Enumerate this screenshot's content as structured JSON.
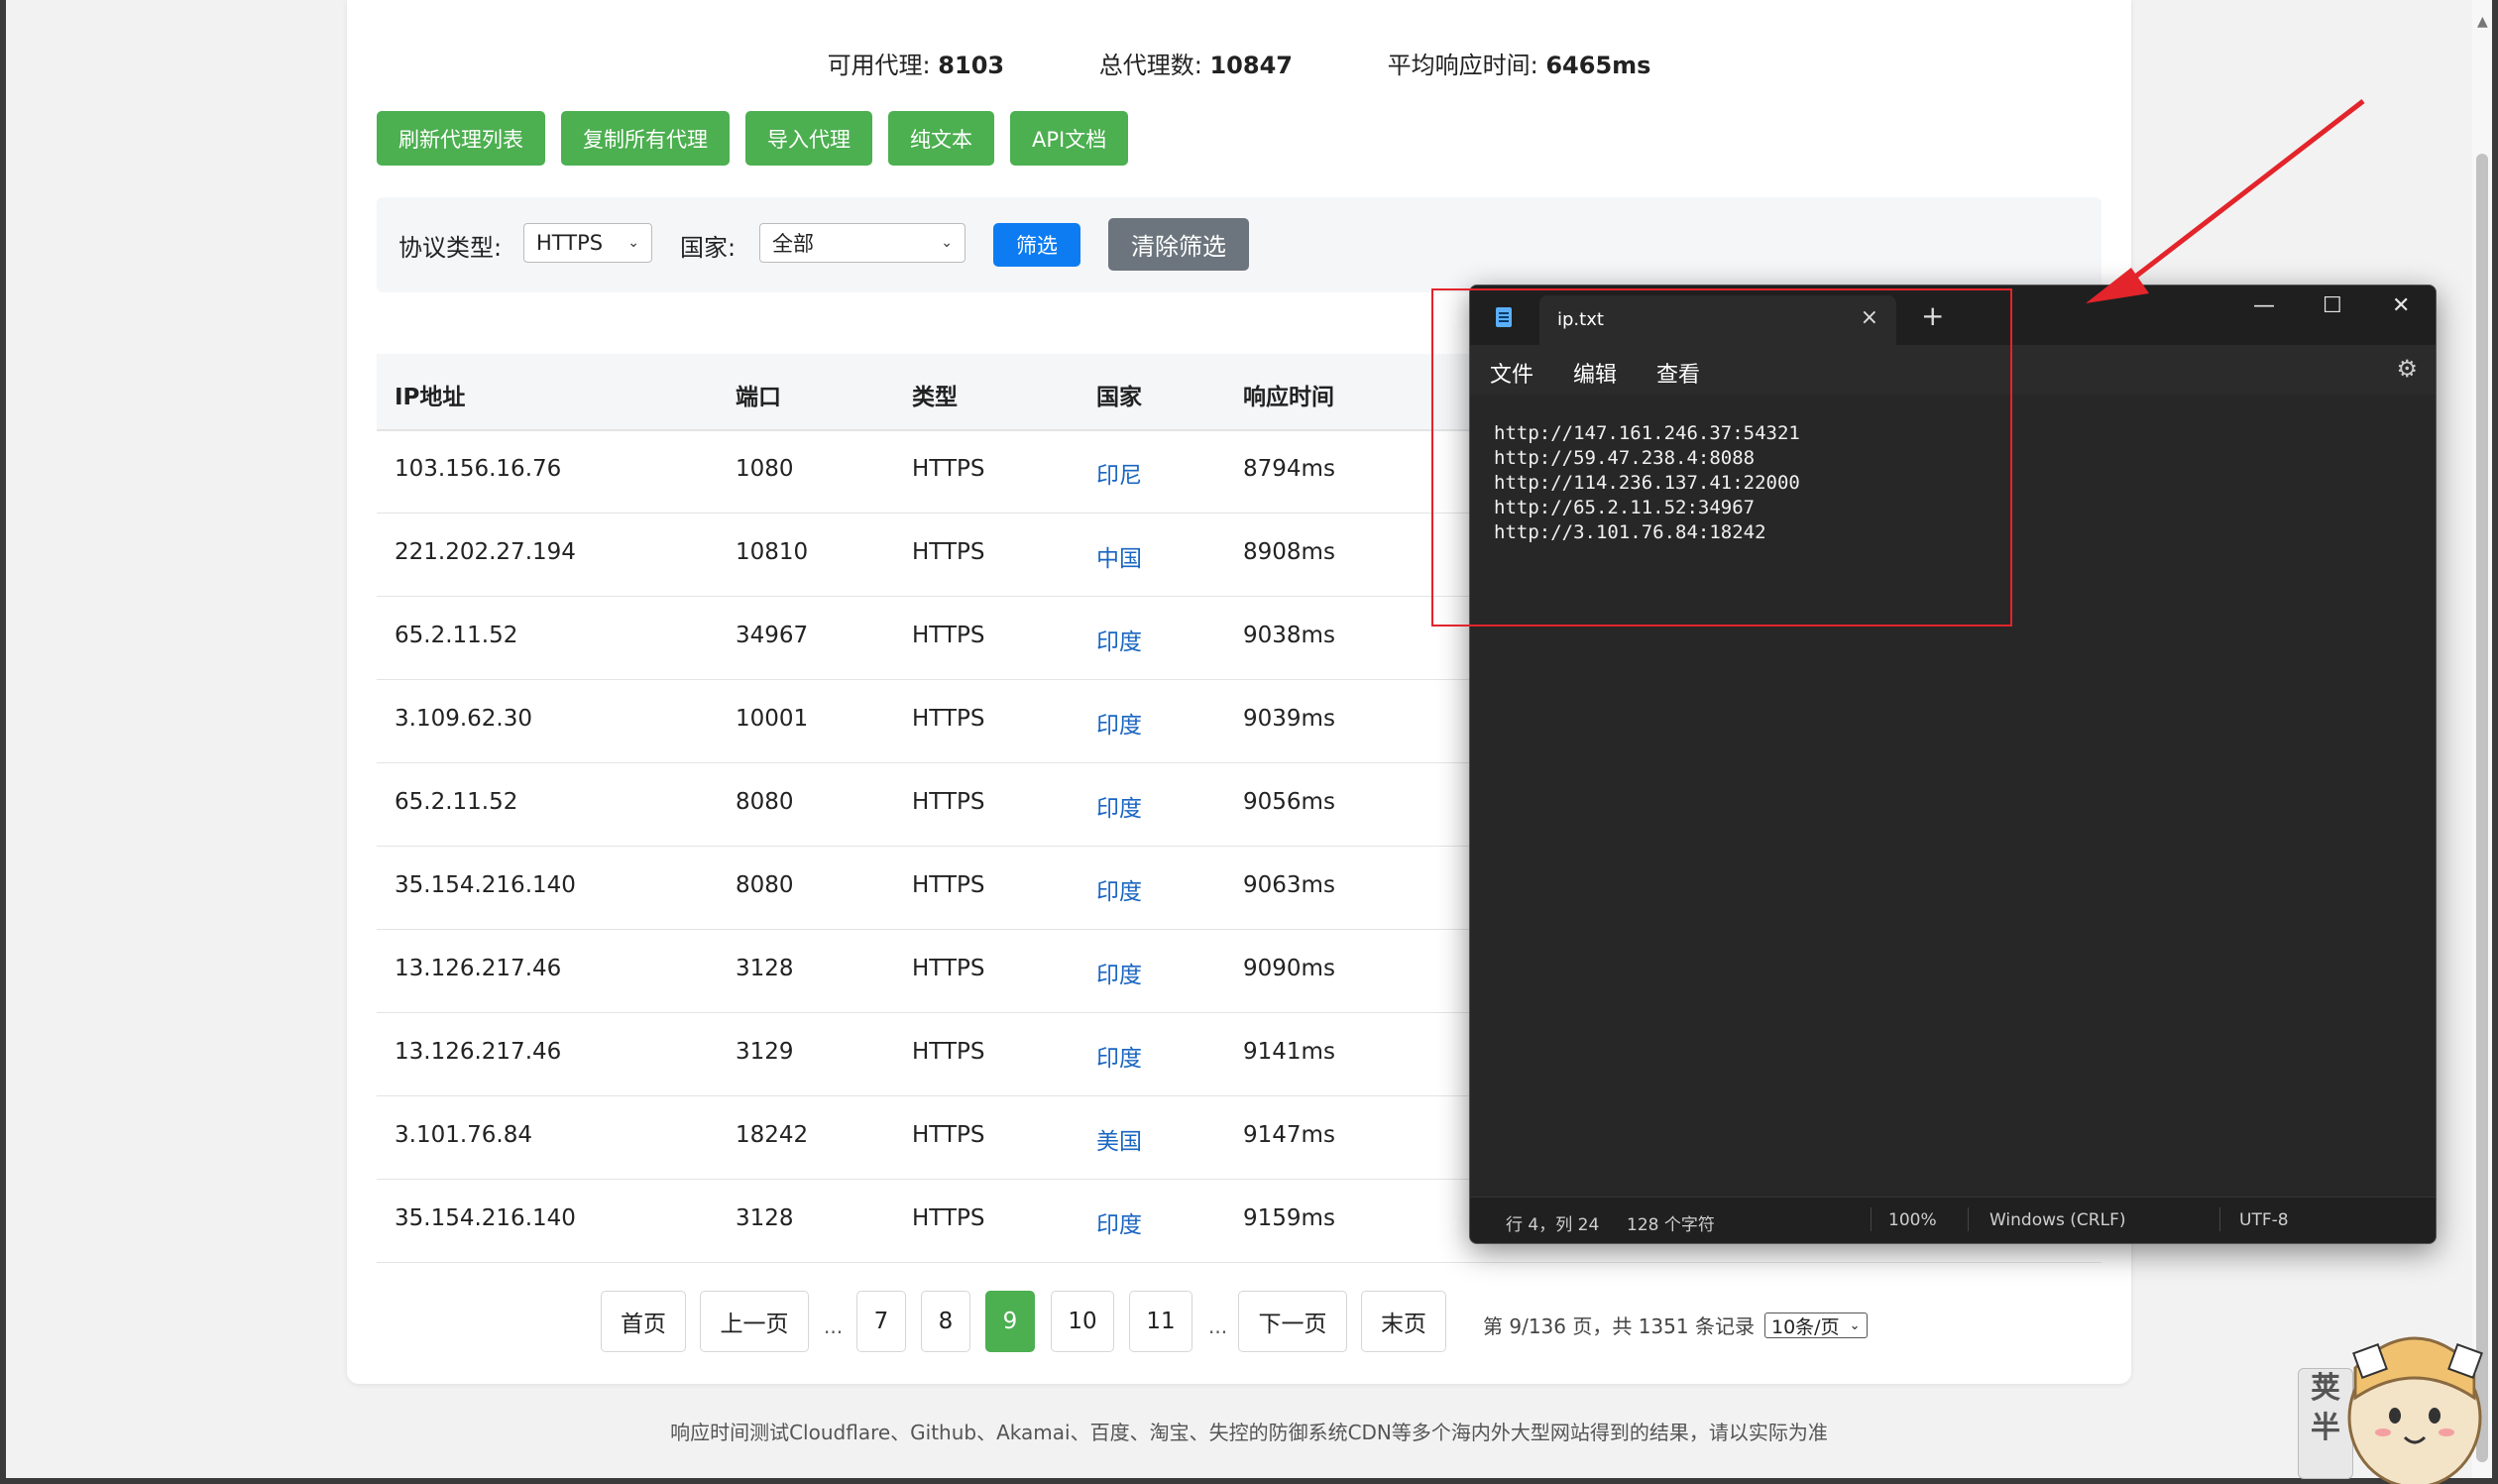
{
  "stats": {
    "available_label": "可用代理:",
    "available_value": "8103",
    "total_label": "总代理数:",
    "total_value": "10847",
    "avg_label": "平均响应时间:",
    "avg_value": "6465ms"
  },
  "buttons": {
    "refresh": "刷新代理列表",
    "copy_all": "复制所有代理",
    "import": "导入代理",
    "plain_text": "纯文本",
    "api_docs": "API文档"
  },
  "filter": {
    "protocol_label": "协议类型:",
    "protocol_value": "HTTPS",
    "country_label": "国家:",
    "country_value": "全部",
    "apply_label": "筛选",
    "clear_label": "清除筛选"
  },
  "table": {
    "headers": [
      "IP地址",
      "端口",
      "类型",
      "国家",
      "响应时间"
    ],
    "rows": [
      [
        "103.156.16.76",
        "1080",
        "HTTPS",
        "印尼",
        "8794ms"
      ],
      [
        "221.202.27.194",
        "10810",
        "HTTPS",
        "中国",
        "8908ms"
      ],
      [
        "65.2.11.52",
        "34967",
        "HTTPS",
        "印度",
        "9038ms"
      ],
      [
        "3.109.62.30",
        "10001",
        "HTTPS",
        "印度",
        "9039ms"
      ],
      [
        "65.2.11.52",
        "8080",
        "HTTPS",
        "印度",
        "9056ms"
      ],
      [
        "35.154.216.140",
        "8080",
        "HTTPS",
        "印度",
        "9063ms"
      ],
      [
        "13.126.217.46",
        "3128",
        "HTTPS",
        "印度",
        "9090ms"
      ],
      [
        "13.126.217.46",
        "3129",
        "HTTPS",
        "印度",
        "9141ms"
      ],
      [
        "3.101.76.84",
        "18242",
        "HTTPS",
        "美国",
        "9147ms"
      ],
      [
        "35.154.216.140",
        "3128",
        "HTTPS",
        "印度",
        "9159ms"
      ]
    ]
  },
  "pagination": {
    "first": "首页",
    "prev": "上一页",
    "ellipsis": "...",
    "pages": [
      "7",
      "8",
      "9",
      "10",
      "11"
    ],
    "current_page": "9",
    "next": "下一页",
    "last": "末页",
    "info": "第 9/136 页，共 1351 条记录",
    "page_size": "10条/页"
  },
  "footer_note": "响应时间测试Cloudflare、Github、Akamai、百度、淘宝、失控的防御系统CDN等多个海内外大型网站得到的结果，请以实际为准",
  "notepad": {
    "tab_title": "ip.txt",
    "menu": [
      "文件",
      "编辑",
      "查看"
    ],
    "lines": [
      "http://147.161.246.37:54321",
      "http://59.47.238.4:8088",
      "http://114.236.137.41:22000",
      "http://65.2.11.52:34967",
      "http://3.101.76.84:18242"
    ],
    "status": {
      "position": "行 4，列 24",
      "chars": "128 个字符",
      "zoom": "100%",
      "line_ending": "Windows (CRLF)",
      "encoding": "UTF-8"
    }
  },
  "watermark": {
    "stamp_text": "荚半"
  },
  "colors": {
    "green": "#4caf50",
    "blue": "#0d7cf2",
    "gray": "#6c757d",
    "annotation_red": "#e3242b"
  }
}
